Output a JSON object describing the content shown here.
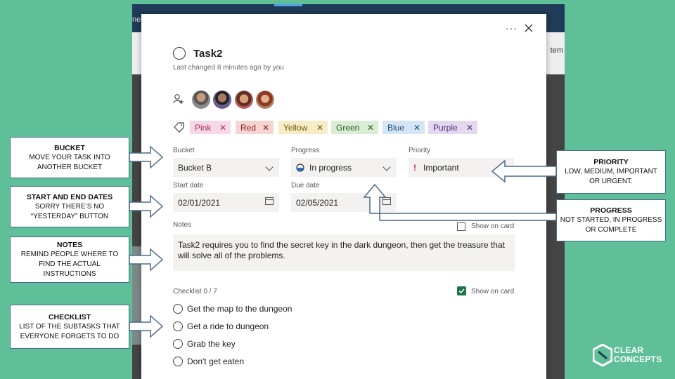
{
  "task": {
    "title": "Task2",
    "last_changed": "Last changed 8 minutes ago by you"
  },
  "tags": [
    {
      "label": "Pink",
      "bg": "#f8d7e6",
      "fg": "#a0305f"
    },
    {
      "label": "Red",
      "bg": "#f5d4d2",
      "fg": "#8a1f1a"
    },
    {
      "label": "Yellow",
      "bg": "#f7ecc6",
      "fg": "#6f5a10"
    },
    {
      "label": "Green",
      "bg": "#d9ecd4",
      "fg": "#2d5a25"
    },
    {
      "label": "Blue",
      "bg": "#d4e6f5",
      "fg": "#1f4f7a"
    },
    {
      "label": "Purple",
      "bg": "#e3d8ef",
      "fg": "#4f3275"
    }
  ],
  "fields": {
    "bucket_label": "Bucket",
    "bucket_value": "Bucket B",
    "progress_label": "Progress",
    "progress_value": "In progress",
    "priority_label": "Priority",
    "priority_value": "Important",
    "start_label": "Start date",
    "start_value": "02/01/2021",
    "due_label": "Due date",
    "due_value": "02/05/2021"
  },
  "notes": {
    "label": "Notes",
    "show_on_card": "Show on card",
    "text": "Task2 requires you to find the secret key in the dark dungeon, then get the treasure that will solve all of the problems."
  },
  "checklist": {
    "label": "Checklist 0 / 7",
    "show_on_card": "Show on card",
    "items": [
      "Get the map to the dungeon",
      "Get a ride to dungeon",
      "Grab the key",
      "Don't get eaten"
    ]
  },
  "callouts": {
    "bucket": {
      "title": "BUCKET",
      "line1": "MOVE YOUR TASK INTO",
      "line2": "ANOTHER BUCKET"
    },
    "dates": {
      "title": "START AND END DATES",
      "line1": "SORRY THERE’S NO",
      "line2": "“YESTERDAY” BUTTON"
    },
    "notes": {
      "title": "NOTES",
      "line1": "REMIND PEOPLE WHERE TO",
      "line2": "FIND THE ACTUAL",
      "line3": "INSTRUCTIONS"
    },
    "checklist": {
      "title": "CHECKLIST",
      "line1": "LIST OF THE SUBTASKS THAT",
      "line2": "EVERYONE FORGETS TO DO"
    },
    "priority": {
      "title": "PRIORITY",
      "line1": "LOW, MEDIUM, IMPORTANT",
      "line2": "OR URGENT."
    },
    "progress": {
      "title": "PROGRESS",
      "line1": "NOT STARTED, IN PROGRESS",
      "line2": "OR COMPLETE"
    }
  },
  "logo": {
    "line1": "CLEAR",
    "line2": "CONCEPTS"
  },
  "background": {
    "text_left": "ne",
    "text_right": "tem"
  },
  "icons": {
    "more": "more-options-icon",
    "close": "close-icon",
    "assign": "assign-person-icon",
    "tag": "tag-icon",
    "calendar": "calendar-icon",
    "checkbox": "checked-checkbox-icon"
  },
  "colors": {
    "background": "#5fbf98",
    "callout_border": "#4a6b8a",
    "checkbox_green": "#217346",
    "priority_red": "#c4314b"
  }
}
